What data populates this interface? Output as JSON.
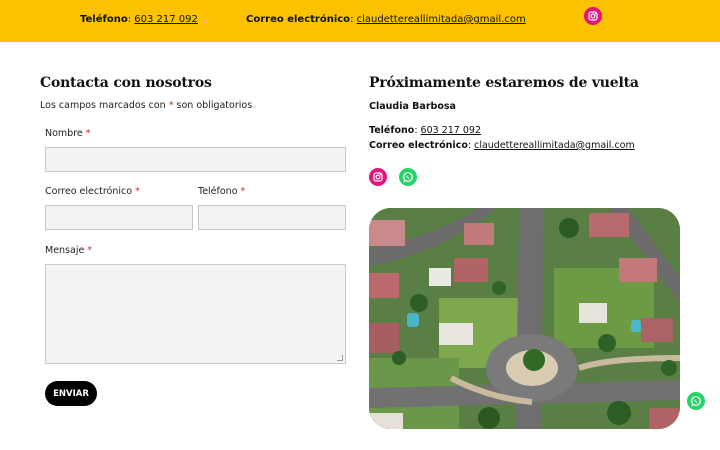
{
  "topbar": {
    "phone_label": "Teléfono",
    "phone_value": "603 217 092",
    "email_label": "Correo electrónico",
    "email_value": "claudettereallimitada@gmail.com",
    "social_icon": "instagram-icon"
  },
  "contact": {
    "title": "Contacta con nosotros",
    "required_note_before": "Los campos marcados con",
    "required_mark": "*",
    "required_note_after": "son obligatorios",
    "fields": {
      "name_label": "Nombre",
      "email_label": "Correo electrónico",
      "phone_label": "Teléfono",
      "message_label": "Mensaje"
    },
    "submit_label": "ENVIAR"
  },
  "info": {
    "title": "Próximamente estaremos de vuelta",
    "person": "Claudia Barbosa",
    "phone_label": "Teléfono",
    "phone_value": "603 217 092",
    "email_label": "Correo electrónico",
    "email_value": "claudettereallimitada@gmail.com",
    "social_icons": [
      "instagram-icon",
      "whatsapp-icon"
    ]
  },
  "floating_icon": "whatsapp-icon",
  "colors": {
    "topbar": "#fcc200",
    "instagram": "#e4157d",
    "whatsapp": "#25d366",
    "button": "#000000",
    "required": "#dd2222"
  }
}
